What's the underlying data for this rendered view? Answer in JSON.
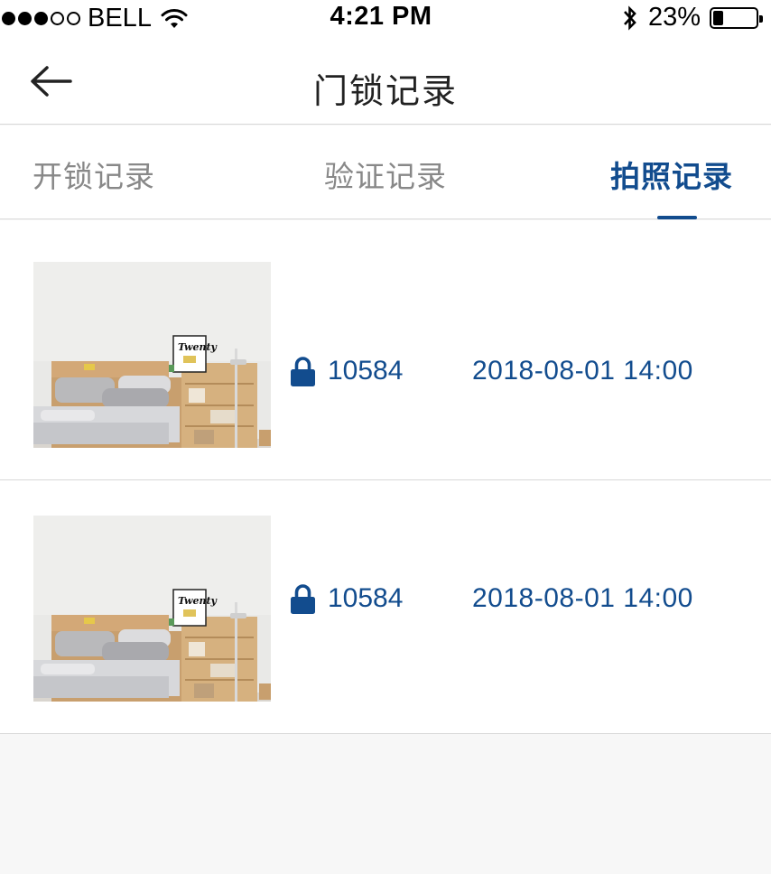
{
  "status_bar": {
    "carrier": "BELL",
    "time": "4:21 PM",
    "battery_pct": "23%",
    "battery_level": 0.23,
    "signal_bars": [
      true,
      true,
      true,
      false,
      false
    ]
  },
  "nav": {
    "title": "门锁记录",
    "back_icon": "arrow-left-icon"
  },
  "tabs": [
    {
      "label": "开锁记录",
      "active": false
    },
    {
      "label": "验证记录",
      "active": false
    },
    {
      "label": "拍照记录",
      "active": true
    }
  ],
  "records": [
    {
      "user_id": "10584",
      "time": "2018-08-01 14:00",
      "icon": "lock-icon"
    },
    {
      "user_id": "10584",
      "time": "2018-08-01 14:00",
      "icon": "lock-icon"
    }
  ],
  "colors": {
    "accent": "#124c8e",
    "inactive_tab": "#888888",
    "divider": "#d8d8d8",
    "background": "#f7f7f7"
  }
}
